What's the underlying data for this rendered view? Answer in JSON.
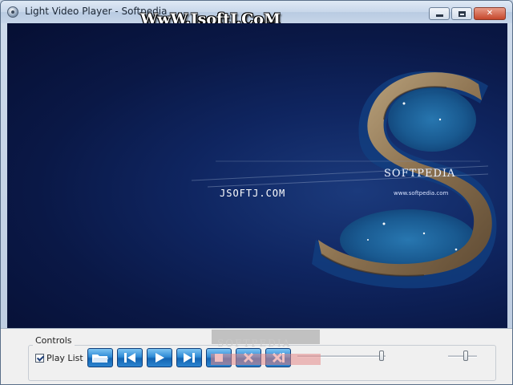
{
  "window": {
    "title": "Light Video Player - Softpedia",
    "watermark": "WwW.JsoftJ.CoM"
  },
  "video": {
    "logo_text": "SOFTPEDIA",
    "logo_url": "www.softpedia.com",
    "center_watermark": "JSOFTJ.COM"
  },
  "controls": {
    "group_label": "Controls",
    "playlist_label": "Play List",
    "playlist_checked": true,
    "buttons": [
      {
        "name": "open-button",
        "icon": "folder-open-icon"
      },
      {
        "name": "previous-button",
        "icon": "skip-previous-icon"
      },
      {
        "name": "play-button",
        "icon": "play-icon"
      },
      {
        "name": "next-button",
        "icon": "skip-next-icon"
      },
      {
        "name": "stop-button",
        "icon": "stop-icon"
      },
      {
        "name": "close-file-button",
        "icon": "x-icon"
      },
      {
        "name": "close-all-button",
        "icon": "close-all-icon"
      }
    ],
    "seek_position": 0.95,
    "volume_position": 0.6
  },
  "overlay": {
    "watermark": "SOFTPEDIA"
  }
}
